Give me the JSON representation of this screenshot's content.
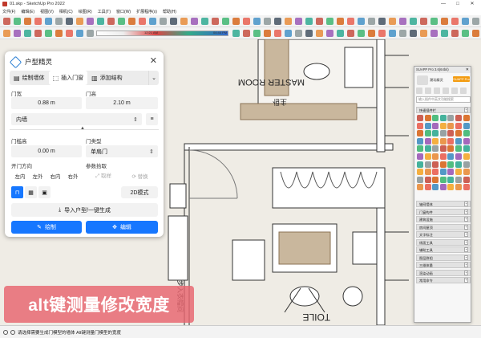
{
  "window": {
    "title": "01.skp - SketchUp Pro 2022",
    "controls": [
      "—",
      "□",
      "✕"
    ]
  },
  "menu": [
    "文件(F)",
    "编辑(E)",
    "视图(V)",
    "相机(C)",
    "绘图(R)",
    "工具(T)",
    "窗口(W)",
    "扩展程序(x)",
    "帮助(H)"
  ],
  "toolbar": {
    "ruler_left": "12:21 AM",
    "ruler_right": "04:44 PM"
  },
  "status": {
    "text": "请选择需要生成门模型的墙体 Alt键测量门模型的宽度"
  },
  "plan": {
    "room_label_rotated": "MASTER ROOM",
    "room_label_cn": "主卧",
    "toilet_label": "TOILE",
    "wardrobe_label": "步入衣帽间"
  },
  "panel": {
    "title": "户型精灵",
    "tabs": [
      {
        "icon": "▤",
        "label": "绘制墙体"
      },
      {
        "icon": "⬚",
        "label": "插入门窗"
      },
      {
        "icon": "▥",
        "label": "添加结构"
      }
    ],
    "more": "⌄",
    "door_width_label": "门宽",
    "door_width": "0.88 m",
    "door_height_label": "门高",
    "door_height": "2.10 m",
    "wall_type": "内墙",
    "sill_label": "门槛高",
    "sill_height": "0.00 m",
    "door_type_label": "门类型",
    "door_type": "单扇门",
    "direction_label": "开门方向",
    "directions": [
      "左内",
      "左外",
      "右内",
      "右外"
    ],
    "param_label": "参数拾取",
    "pick_label": "⤢ 取样",
    "replace_label": "⟳ 替换",
    "mode_2d": "2D模式",
    "import_label": "导入户型/一键生成",
    "draw_label": "绘制",
    "edit_label": "编辑"
  },
  "suapp": {
    "title": "SUAPP Pro 3.6(64bit)",
    "badge": "SUAPP Pro",
    "username": "潮玩精灵",
    "search_placeholder": "输入插件中英文功能搜索",
    "sections": [
      "快速插件栏",
      "轴网墙体",
      "门窗构件",
      "建筑设施",
      "房间屋顶",
      "文字标注",
      "线面工具",
      "辅助工具",
      "图层群组",
      "三维体量",
      "渲染动画",
      "常用命令"
    ],
    "footer": "常用命令"
  },
  "caption": "alt键测量修改宽度",
  "colors": {
    "accent": "#1677ff",
    "caption_bg": "#e8646e",
    "badge": "#f39c12"
  }
}
